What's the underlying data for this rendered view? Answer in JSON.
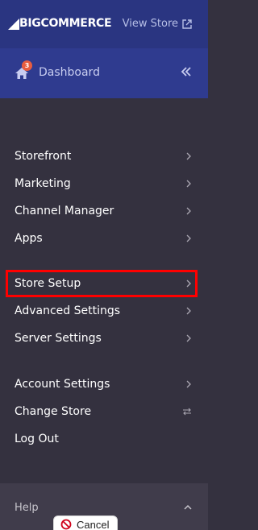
{
  "header": {
    "logo_text": "BIGCOMMERCE",
    "view_store_label": "View Store",
    "dashboard_label": "Dashboard",
    "notification_count": "3"
  },
  "menu": {
    "group1": [
      {
        "label": "Storefront"
      },
      {
        "label": "Marketing"
      },
      {
        "label": "Channel Manager"
      },
      {
        "label": "Apps"
      }
    ],
    "group2": [
      {
        "label": "Store Setup"
      },
      {
        "label": "Advanced Settings"
      },
      {
        "label": "Server Settings"
      }
    ],
    "group3": [
      {
        "label": "Account Settings"
      },
      {
        "label": "Change Store"
      },
      {
        "label": "Log Out"
      }
    ]
  },
  "footer": {
    "help_label": "Help",
    "cancel_label": "Cancel"
  },
  "colors": {
    "header_bg": "#2f3b8f",
    "sidebar_bg": "#34313f",
    "highlight": "#ff0000",
    "badge": "#e85d3f"
  },
  "icons": [
    "view-store-external-icon",
    "home-icon",
    "collapse-double-chevron-icon",
    "chevron-right-icon",
    "swap-icon",
    "chevron-up-icon",
    "no-entry-icon"
  ]
}
